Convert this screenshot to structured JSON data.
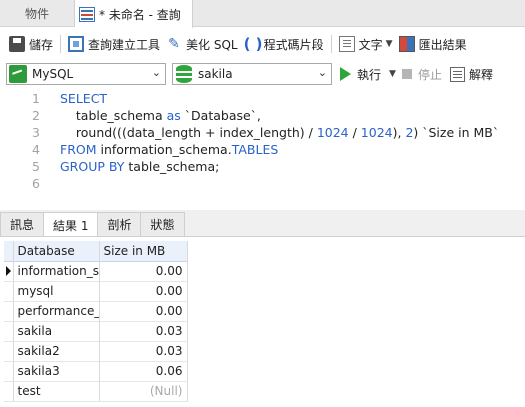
{
  "tabs": {
    "objects": "物件",
    "query": "* 未命名 - 查詢"
  },
  "toolbar": {
    "save": "儲存",
    "query_builder": "查詢建立工具",
    "beautify": "美化 SQL",
    "snippet": "程式碼片段",
    "text": "文字",
    "export": "匯出結果"
  },
  "connection": {
    "name": "MySQL",
    "database": "sakila",
    "run": "執行",
    "stop": "停止",
    "explain": "解釋"
  },
  "editor": {
    "line_numbers": [
      "1",
      "2",
      "3",
      "4",
      "5",
      "6"
    ],
    "lines": [
      [
        {
          "t": "SELECT",
          "c": "kw"
        }
      ],
      [
        {
          "t": "    table_schema ",
          "c": ""
        },
        {
          "t": "as",
          "c": "kw"
        },
        {
          "t": " `Database`,",
          "c": ""
        }
      ],
      [
        {
          "t": "    round(((data_length + index_length) / ",
          "c": ""
        },
        {
          "t": "1024",
          "c": "num"
        },
        {
          "t": " / ",
          "c": ""
        },
        {
          "t": "1024",
          "c": "num"
        },
        {
          "t": "), ",
          "c": ""
        },
        {
          "t": "2",
          "c": "num"
        },
        {
          "t": ") `Size in MB`",
          "c": ""
        }
      ],
      [
        {
          "t": "FROM",
          "c": "kw"
        },
        {
          "t": " information_schema.",
          "c": ""
        },
        {
          "t": "TABLES",
          "c": "kw"
        }
      ],
      [
        {
          "t": "GROUP BY",
          "c": "kw"
        },
        {
          "t": " table_schema;",
          "c": ""
        }
      ],
      []
    ]
  },
  "result_tabs": [
    "訊息",
    "結果 1",
    "剖析",
    "狀態"
  ],
  "active_result_tab": 1,
  "grid": {
    "columns": [
      "Database",
      "Size in MB"
    ],
    "rows": [
      {
        "database": "information_sc",
        "size": "0.00",
        "current": true
      },
      {
        "database": "mysql",
        "size": "0.00"
      },
      {
        "database": "performance_s",
        "size": "0.00"
      },
      {
        "database": "sakila",
        "size": "0.03"
      },
      {
        "database": "sakila2",
        "size": "0.03"
      },
      {
        "database": "sakila3",
        "size": "0.06"
      },
      {
        "database": "test",
        "size": "(Null)",
        "null": true
      }
    ]
  },
  "colors": {
    "keyword": "#2a62c9",
    "accent_green": "#2fa63c",
    "header_bg": "#eaf1fb"
  }
}
